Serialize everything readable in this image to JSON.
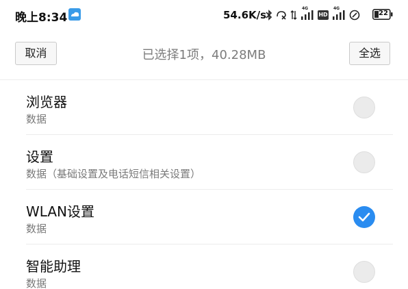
{
  "status_bar": {
    "time": "晚上8:34",
    "net_speed": "54.6K/s",
    "battery": "22",
    "icons": [
      "weather-icon",
      "bluetooth-icon",
      "alarm-off-icon",
      "data-arrows-icon",
      "signal-4g-icon",
      "hd-icon",
      "signal-4g-icon",
      "sync-icon",
      "battery-icon"
    ],
    "network_label_1": "4G",
    "hd_label": "HD",
    "network_label_2": "4G"
  },
  "header": {
    "cancel_label": "取消",
    "title": "已选择1项，40.28MB",
    "select_all_label": "全选"
  },
  "items": [
    {
      "title": "浏览器",
      "subtitle": "数据",
      "checked": false
    },
    {
      "title": "设置",
      "subtitle": "数据（基础设置及电话短信相关设置）",
      "checked": false
    },
    {
      "title": "WLAN设置",
      "subtitle": "数据",
      "checked": true
    },
    {
      "title": "智能助理",
      "subtitle": "数据",
      "checked": false
    }
  ],
  "colors": {
    "accent": "#2a8cf0",
    "unchecked": "#ebebeb",
    "title_gray": "#7c7c7c"
  }
}
